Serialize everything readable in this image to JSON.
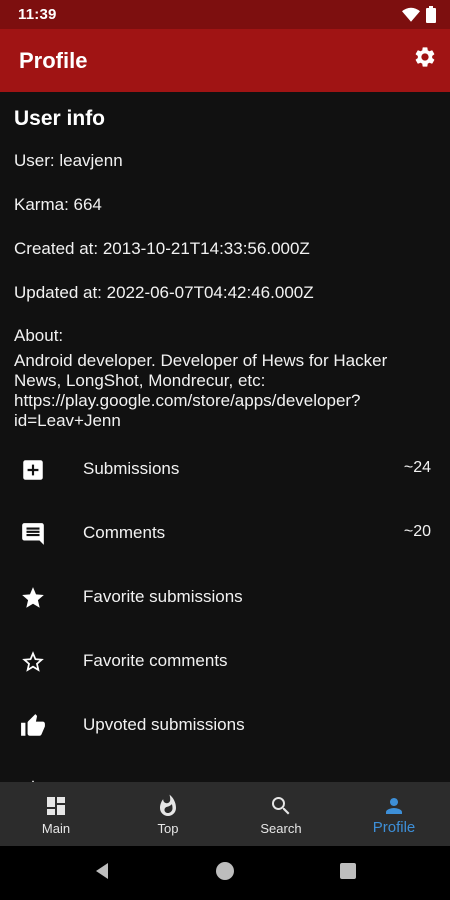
{
  "status_bar": {
    "time": "11:39"
  },
  "app_bar": {
    "title": "Profile"
  },
  "profile": {
    "section_title": "User info",
    "user": "User: leavjenn",
    "karma": "Karma: 664",
    "created": "Created at: 2013-10-21T14:33:56.000Z",
    "updated": "Updated at: 2022-06-07T04:42:46.000Z",
    "about_label": "About:",
    "about_text": "Android developer. Developer of Hews for Hacker News, LongShot, Mondrecur, etc: https://play.google.com/store/apps/developer?id=Leav+Jenn"
  },
  "menu": [
    {
      "label": "Submissions",
      "count": "~24",
      "icon": "add-box-icon"
    },
    {
      "label": "Comments",
      "count": "~20",
      "icon": "comment-icon"
    },
    {
      "label": "Favorite submissions",
      "count": "",
      "icon": "star-filled-icon"
    },
    {
      "label": "Favorite comments",
      "count": "",
      "icon": "star-outline-icon"
    },
    {
      "label": "Upvoted submissions",
      "count": "",
      "icon": "thumb-up-icon"
    }
  ],
  "bottom_nav": [
    {
      "label": "Main",
      "icon": "dashboard-icon",
      "active": false
    },
    {
      "label": "Top",
      "icon": "fire-icon",
      "active": false
    },
    {
      "label": "Search",
      "icon": "search-icon",
      "active": false
    },
    {
      "label": "Profile",
      "icon": "person-icon",
      "active": true
    }
  ],
  "colors": {
    "status_bar": "#7d0f0f",
    "app_bar": "#a01414",
    "background": "#111111",
    "bottom_nav": "#2c2c2c",
    "accent": "#3d8fd8"
  }
}
